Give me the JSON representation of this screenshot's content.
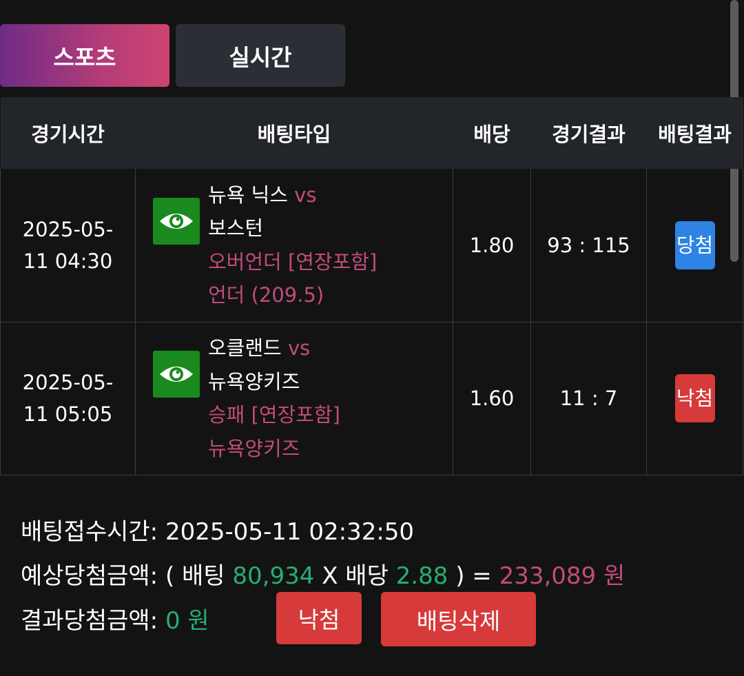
{
  "tabs": [
    {
      "label": "스포츠",
      "active": true
    },
    {
      "label": "실시간",
      "active": false
    }
  ],
  "table": {
    "headers": [
      "경기시간",
      "배팅타입",
      "배당",
      "경기결과",
      "배팅결과"
    ],
    "rows": [
      {
        "time_line1": "2025-05-",
        "time_line2": "11 04:30",
        "team_home": "뉴욕 닉스",
        "vs": "vs",
        "team_away": "보스턴",
        "market": "오버언더 [연장포함]",
        "pick": "언더 (209.5)",
        "odds": "1.80",
        "score": "93 : 115",
        "result": "당첨",
        "result_color": "#2f83e4"
      },
      {
        "time_line1": "2025-05-",
        "time_line2": "11 05:05",
        "team_home": "오클랜드",
        "vs": "vs",
        "team_away": "뉴욕양키즈",
        "market": "승패 [연장포함]",
        "pick": "뉴욕양키즈",
        "odds": "1.60",
        "score": "11 : 7",
        "result": "낙첨",
        "result_color": "#d63a3a"
      }
    ]
  },
  "summary": {
    "received_label": "배팅접수시간:",
    "received_value": "2025-05-11 02:32:50",
    "expected_label": "예상당첨금액:",
    "expected_open": "( 배팅",
    "bet_amount": "80,934",
    "x_label": "X 배당",
    "total_odds": "2.88",
    "expected_close": ") =",
    "expected_amount": "233,089 원",
    "result_label": "결과당첨금액:",
    "result_amount": "0 원"
  },
  "buttons": {
    "status": "낙첨",
    "delete": "배팅삭제"
  },
  "colors": {
    "accent_pink": "#c24b7c",
    "green": "#27ae71",
    "win": "#2f83e4",
    "lose": "#d63a3a"
  },
  "icons": {
    "bet_detail": "eye-icon"
  }
}
